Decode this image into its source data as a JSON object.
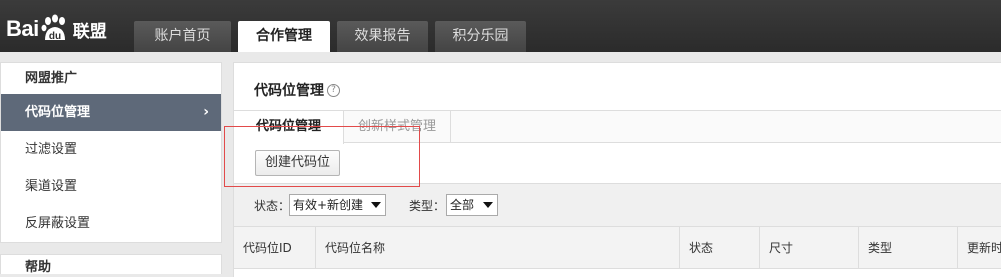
{
  "header": {
    "logo": {
      "text_latin_1": "Bai",
      "paw_text": "du",
      "text_cn": "联盟"
    },
    "tabs": [
      {
        "label": "账户首页",
        "active": false
      },
      {
        "label": "合作管理",
        "active": true
      },
      {
        "label": "效果报告",
        "active": false
      },
      {
        "label": "积分乐园",
        "active": false
      }
    ]
  },
  "sidebar": {
    "section_title": "网盟推广",
    "items": [
      {
        "label": "代码位管理",
        "active": true,
        "arrow": "›"
      },
      {
        "label": "过滤设置",
        "active": false
      },
      {
        "label": "渠道设置",
        "active": false
      },
      {
        "label": "反屏蔽设置",
        "active": false
      }
    ],
    "help_title": "帮助"
  },
  "main": {
    "title": "代码位管理",
    "help_icon": "?",
    "subtabs": [
      {
        "label": "代码位管理",
        "active": true
      },
      {
        "label": "创新样式管理",
        "active": false
      }
    ],
    "create_button": "创建代码位",
    "filters": {
      "status_label": "状态：",
      "status_value": "有效+新创建",
      "type_label": "类型：",
      "type_value": "全部"
    },
    "table_headers": [
      "代码位ID",
      "代码位名称",
      "状态",
      "尺寸",
      "类型",
      "更新时"
    ]
  },
  "colors": {
    "header_bg": "#2f2f2f",
    "sidebar_active": "#5e6979",
    "highlight_border": "#e24a4a"
  }
}
